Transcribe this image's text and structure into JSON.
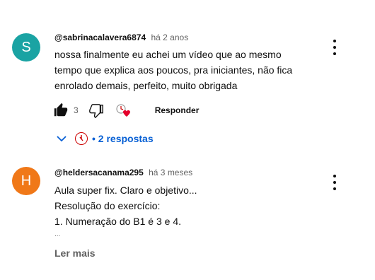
{
  "comments": [
    {
      "avatar_letter": "S",
      "avatar_color": "#1aa3a3",
      "handle": "@sabrinacalavera6874",
      "time": "há 2 anos",
      "lines": [
        "nossa finalmente eu achei um vídeo que ao mesmo",
        "tempo que explica aos poucos, pra iniciantes, não fica",
        "enrolado demais, perfeito, muito obrigada"
      ],
      "likes": "3",
      "reply_label": "Responder",
      "replies_label": "• 2 respostas"
    },
    {
      "avatar_letter": "H",
      "avatar_color": "#f07818",
      "handle": "@heldersacanama295",
      "time": "há 3 meses",
      "lines": [
        "Aula super fix. Claro e objetivo...",
        "Resolução do exercício:",
        "1. Numeração do B1 é  3 e 4.",
        "..."
      ],
      "more_label": "Ler mais"
    }
  ],
  "icons": {
    "like": "thumbs-up-filled-icon",
    "dislike": "thumbs-down-icon",
    "creator_heart": "creator-heart-icon",
    "expand": "chevron-down-icon",
    "more": "more-vert-icon",
    "accent": "#065fd4",
    "heart_color": "#e4002b"
  }
}
